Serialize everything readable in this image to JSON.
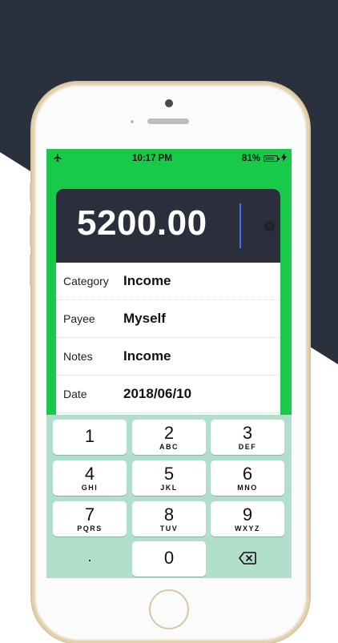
{
  "statusbar": {
    "airplane_icon": "airplane-icon",
    "time": "10:17 PM",
    "battery_percent": "81%",
    "battery_level": 0.81,
    "charging_icon": "bolt-icon"
  },
  "colors": {
    "screen_background": "#18c94a",
    "amount_background": "#2b2f3b",
    "keypad_background": "#b2dfcb",
    "cursor": "#4a6cf7"
  },
  "amount": {
    "value": "5200.00",
    "clear_icon": "clear-icon"
  },
  "fields": [
    {
      "label": "Category",
      "value": "Income"
    },
    {
      "label": "Payee",
      "value": "Myself"
    },
    {
      "label": "Notes",
      "value": "Income"
    },
    {
      "label": "Date",
      "value": "2018/06/10"
    }
  ],
  "keypad": {
    "keys": [
      {
        "digit": "1",
        "letters": ""
      },
      {
        "digit": "2",
        "letters": "ABC"
      },
      {
        "digit": "3",
        "letters": "DEF"
      },
      {
        "digit": "4",
        "letters": "GHI"
      },
      {
        "digit": "5",
        "letters": "JKL"
      },
      {
        "digit": "6",
        "letters": "MNO"
      },
      {
        "digit": "7",
        "letters": "PQRS"
      },
      {
        "digit": "8",
        "letters": "TUV"
      },
      {
        "digit": "9",
        "letters": "WXYZ"
      },
      {
        "digit": ".",
        "letters": ""
      },
      {
        "digit": "0",
        "letters": ""
      }
    ],
    "backspace_icon": "backspace-icon"
  }
}
